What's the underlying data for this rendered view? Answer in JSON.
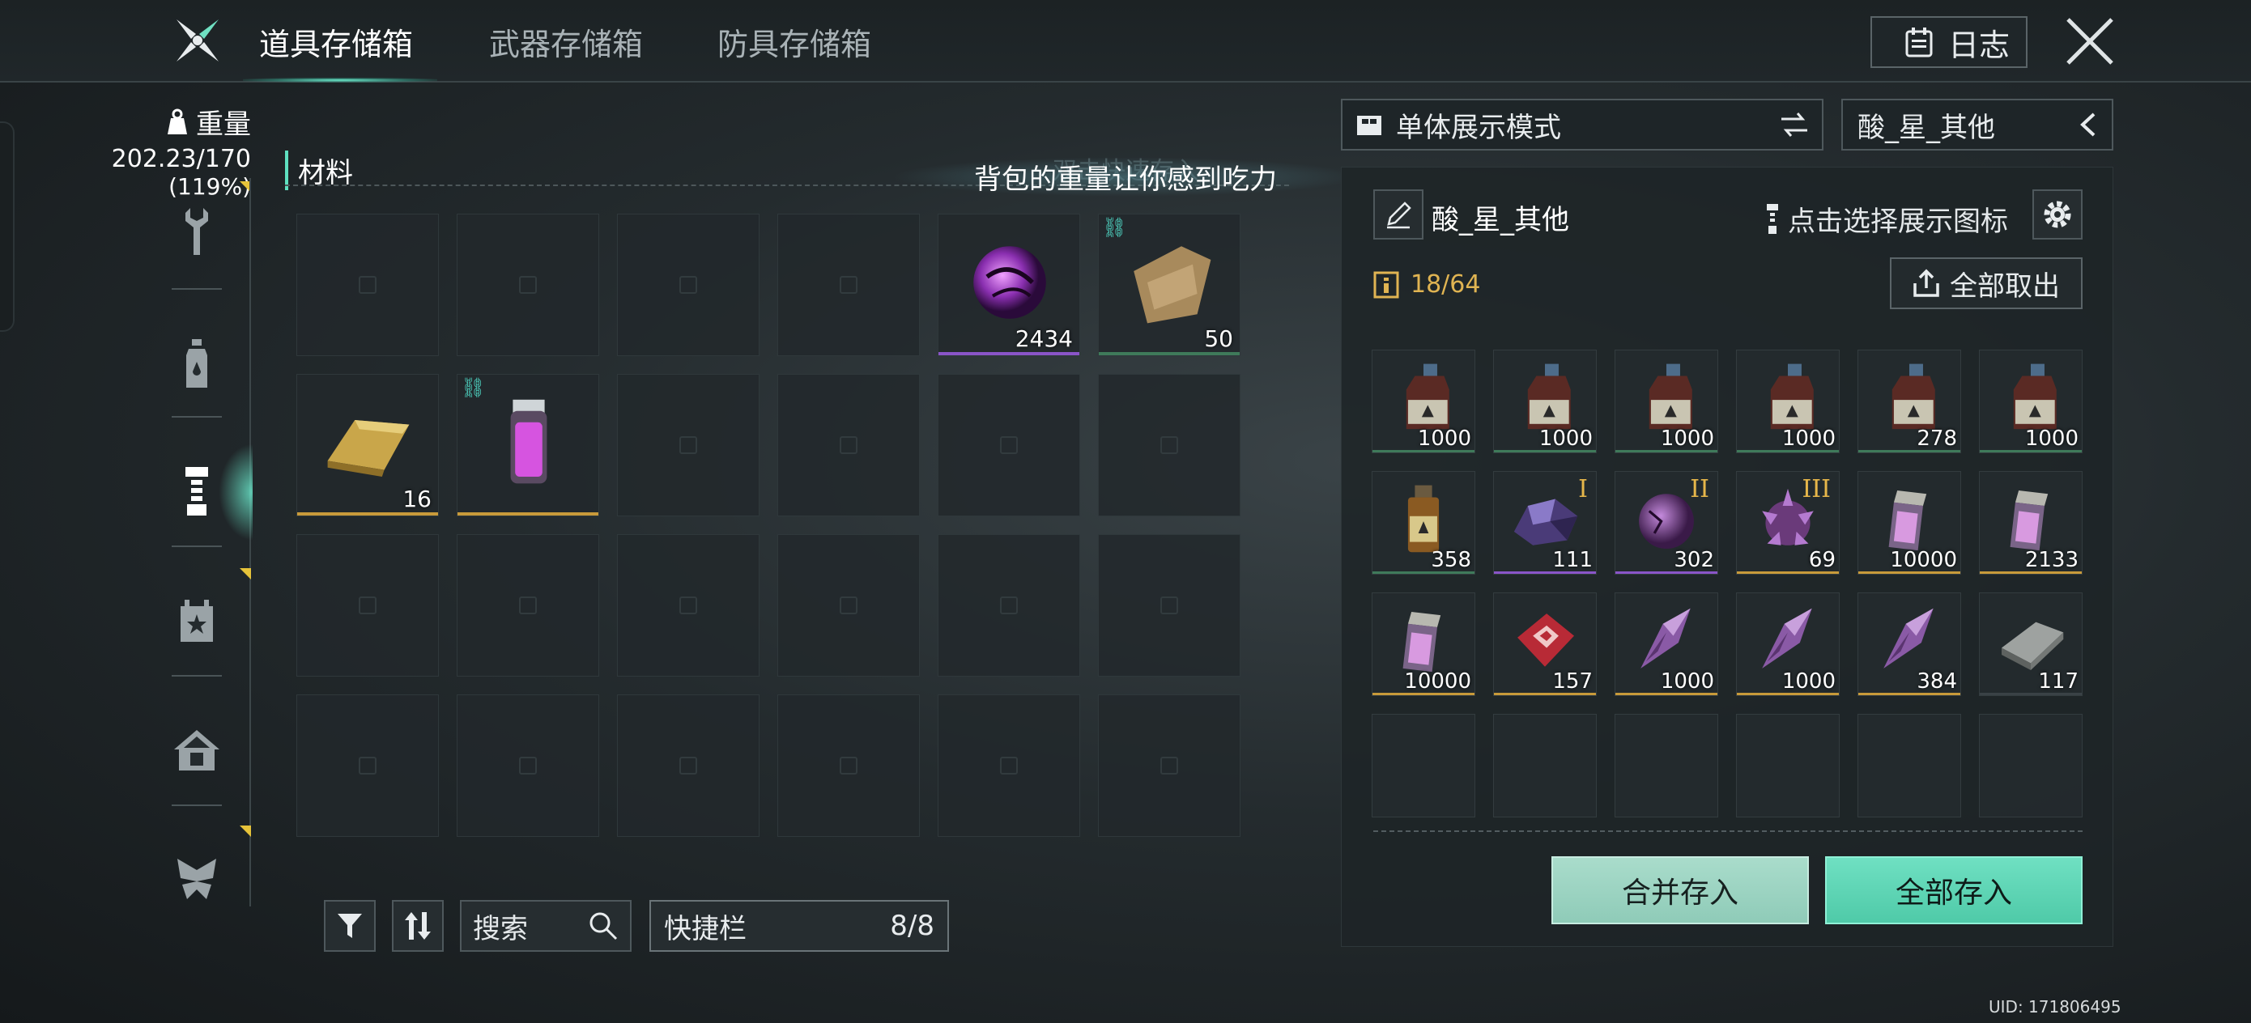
{
  "header": {
    "tabs": [
      {
        "label": "道具存储箱",
        "active": true
      },
      {
        "label": "武器存储箱",
        "active": false
      },
      {
        "label": "防具存储箱",
        "active": false
      }
    ],
    "log_label": "日志"
  },
  "weight": {
    "title": "重量",
    "value": "202.23/170",
    "percent": "(119%)"
  },
  "nav": {
    "icons": [
      "wrench-icon",
      "bottle-icon",
      "tool-icon",
      "star-box-icon",
      "home-icon",
      "butterfly-icon"
    ],
    "active_index": 2
  },
  "storage": {
    "section_label": "材料",
    "ghost_text": "双击快速存入",
    "warning": "背包的重量让你感到吃力",
    "slots": [
      {
        "item": null
      },
      {
        "item": null
      },
      {
        "item": null
      },
      {
        "item": null
      },
      {
        "item": "purple-orb",
        "qty": "2434",
        "rarity": "#8a55c8",
        "linked": false
      },
      {
        "item": "cloth",
        "qty": "50",
        "rarity": "#3f7a5a",
        "linked": true
      },
      {
        "item": "gold-bar",
        "qty": "16",
        "rarity": "#c89a3a",
        "linked": false
      },
      {
        "item": "purple-vial",
        "qty": "",
        "rarity": "#c89a3a",
        "linked": true
      }
    ]
  },
  "toolbar": {
    "search_label": "搜索",
    "quickbar_label": "快捷栏",
    "quickbar_count": "8/8"
  },
  "right": {
    "mode_label": "单体展示模式",
    "category_label": "酸_星_其他",
    "panel_title": "酸_星_其他",
    "icon_hint": "点击选择展示图标",
    "capacity": "18/64",
    "take_all_label": "全部取出",
    "merge_label": "合并存入",
    "store_all_label": "全部存入",
    "items": [
      {
        "item": "brown-bottle",
        "qty": "1000",
        "rarity": "#3f7a5a",
        "tier": ""
      },
      {
        "item": "brown-bottle",
        "qty": "1000",
        "rarity": "#3f7a5a",
        "tier": ""
      },
      {
        "item": "brown-bottle",
        "qty": "1000",
        "rarity": "#3f7a5a",
        "tier": ""
      },
      {
        "item": "brown-bottle",
        "qty": "1000",
        "rarity": "#3f7a5a",
        "tier": ""
      },
      {
        "item": "brown-bottle",
        "qty": "278",
        "rarity": "#3f7a5a",
        "tier": ""
      },
      {
        "item": "brown-bottle",
        "qty": "1000",
        "rarity": "#3f7a5a",
        "tier": ""
      },
      {
        "item": "amber-vial",
        "qty": "358",
        "rarity": "#3f7a5a",
        "tier": ""
      },
      {
        "item": "purple-crystal",
        "qty": "111",
        "rarity": "#8a55c8",
        "tier": "I"
      },
      {
        "item": "purple-ore",
        "qty": "302",
        "rarity": "#8a55c8",
        "tier": "II"
      },
      {
        "item": "purple-cluster",
        "qty": "69",
        "rarity": "#c89a3a",
        "tier": "III"
      },
      {
        "item": "pink-jar",
        "qty": "10000",
        "rarity": "#c89a3a",
        "tier": ""
      },
      {
        "item": "pink-jar",
        "qty": "2133",
        "rarity": "#c89a3a",
        "tier": ""
      },
      {
        "item": "pink-jar",
        "qty": "10000",
        "rarity": "#c89a3a",
        "tier": ""
      },
      {
        "item": "red-chip",
        "qty": "157",
        "rarity": "#c89a3a",
        "tier": ""
      },
      {
        "item": "purple-shard",
        "qty": "1000",
        "rarity": "#c89a3a",
        "tier": ""
      },
      {
        "item": "purple-shard",
        "qty": "1000",
        "rarity": "#c89a3a",
        "tier": ""
      },
      {
        "item": "purple-shard",
        "qty": "384",
        "rarity": "#c89a3a",
        "tier": ""
      },
      {
        "item": "metal-plate",
        "qty": "117",
        "rarity": "#3a4246",
        "tier": ""
      }
    ]
  },
  "uid": "UID: 171806495"
}
